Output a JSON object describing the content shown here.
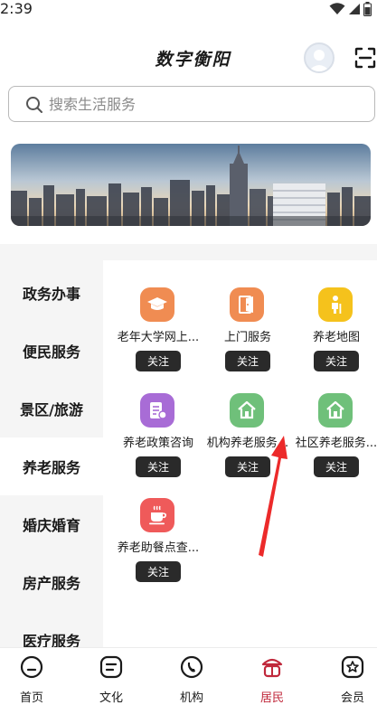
{
  "status_bar": {
    "time": "2:39"
  },
  "header": {
    "title": "数字衡阳"
  },
  "search": {
    "placeholder": "搜索生活服务"
  },
  "sidebar": {
    "categories": [
      {
        "label": "政务办事"
      },
      {
        "label": "便民服务"
      },
      {
        "label": "景区/旅游"
      },
      {
        "label": "养老服务",
        "active": true
      },
      {
        "label": "婚庆婚育"
      },
      {
        "label": "房产服务"
      },
      {
        "label": "医疗服务"
      }
    ]
  },
  "services": {
    "follow_label": "关注",
    "items": [
      {
        "label": "老年大学网上...",
        "icon": "graduation-cap-icon",
        "color": "#f08c52"
      },
      {
        "label": "上门服务",
        "icon": "door-icon",
        "color": "#f08c52"
      },
      {
        "label": "养老地图",
        "icon": "elderly-person-icon",
        "color": "#f5c21c"
      },
      {
        "label": "养老政策咨询",
        "icon": "policy-document-icon",
        "color": "#a86cd6"
      },
      {
        "label": "机构养老服务...",
        "icon": "house-icon",
        "color": "#6fc07a"
      },
      {
        "label": "社区养老服务...",
        "icon": "house-icon",
        "color": "#6fc07a"
      },
      {
        "label": "养老助餐点查...",
        "icon": "coffee-cup-icon",
        "color": "#ef5a5a"
      }
    ]
  },
  "tabbar": {
    "tabs": [
      {
        "label": "首页",
        "icon": "home-icon"
      },
      {
        "label": "文化",
        "icon": "document-icon"
      },
      {
        "label": "机构",
        "icon": "phone-icon"
      },
      {
        "label": "居民",
        "icon": "resident-icon",
        "active": true
      },
      {
        "label": "会员",
        "icon": "member-icon"
      }
    ],
    "active_color": "#c0283b"
  }
}
